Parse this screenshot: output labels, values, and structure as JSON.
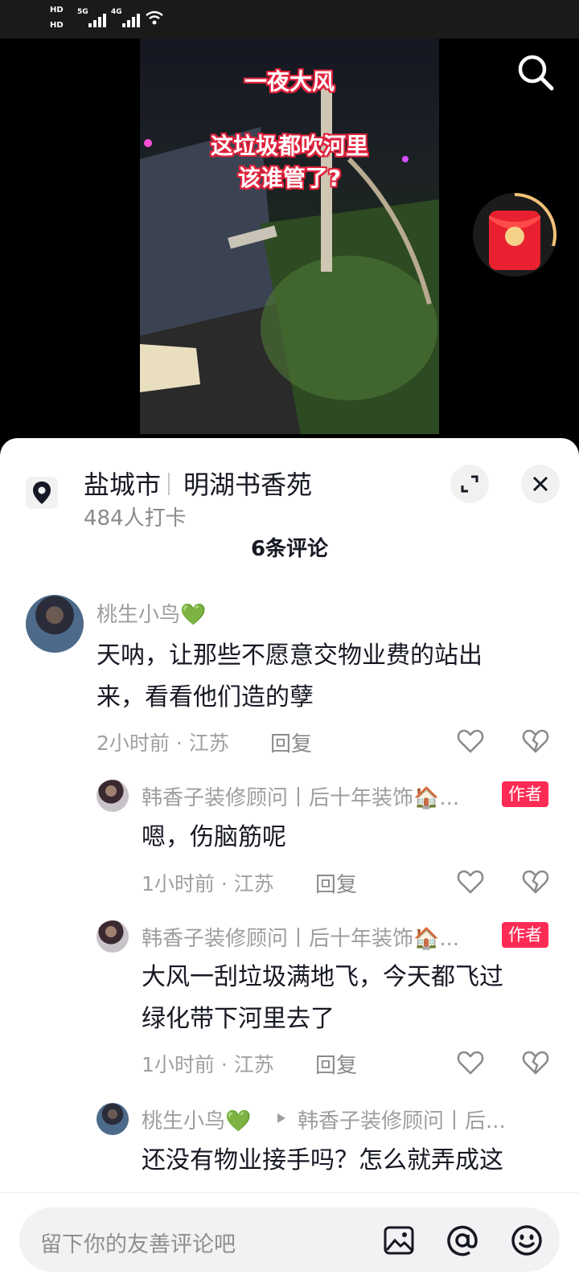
{
  "status_bar": {
    "hd1": "HD",
    "hd2": "HD",
    "net1": "5G",
    "net2": "4G"
  },
  "video": {
    "overlay_line1": "一夜大风",
    "overlay_line2": "这垃圾都吹河里",
    "overlay_line3": "该谁管了?",
    "icons": [
      "search-icon",
      "red-packet-icon"
    ]
  },
  "sheet": {
    "location_icon": "location-pin-icon",
    "city": "盐城市",
    "place": "明湖书香苑",
    "checkins": "484人打卡",
    "comment_count": "6条评论",
    "expand_icon": "expand-icon",
    "close_icon": "close-icon"
  },
  "comments": [
    {
      "name": "桃生小鸟💚",
      "text_line1": "天呐，让那些不愿意交物业费的站出",
      "text_line2": "来，看看他们造的孽",
      "meta": "2小时前 · 江苏",
      "reply": "回复"
    }
  ],
  "replies": [
    {
      "name": "韩香子装修顾问丨后十年装饰🏠...",
      "badge": "作者",
      "text_line1": "嗯，伤脑筋呢",
      "meta": "1小时前 · 江苏",
      "reply": "回复"
    },
    {
      "name": "韩香子装修顾问丨后十年装饰🏠...",
      "badge": "作者",
      "text_line1": "大风一刮垃圾满地飞，今天都飞过",
      "text_line2": "绿化带下河里去了",
      "meta": "1小时前 · 江苏",
      "reply": "回复"
    },
    {
      "name": "桃生小鸟💚",
      "reply_to": "韩香子装修顾问丨后...",
      "text_line1": "还没有物业接手吗？怎么就弄成这"
    }
  ],
  "input": {
    "placeholder": "留下你的友善评论吧",
    "icons": [
      "image-icon",
      "at-icon",
      "emoji-icon"
    ]
  }
}
